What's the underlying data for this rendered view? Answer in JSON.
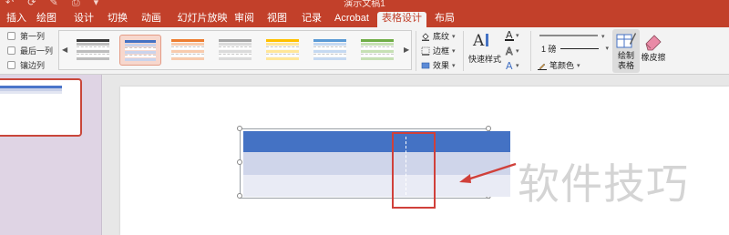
{
  "window": {
    "title": "演示文稿1",
    "accent": "#c2402a"
  },
  "tabs": [
    {
      "label": "插入"
    },
    {
      "label": "绘图"
    },
    {
      "label": "设计"
    },
    {
      "label": "切换"
    },
    {
      "label": "动画"
    },
    {
      "label": "幻灯片放映"
    },
    {
      "label": "审阅"
    },
    {
      "label": "视图"
    },
    {
      "label": "记录"
    },
    {
      "label": "Acrobat"
    },
    {
      "label": "表格设计",
      "active": true
    },
    {
      "label": "布局"
    }
  ],
  "ribbon": {
    "options": [
      {
        "label": "第一列",
        "checked": false
      },
      {
        "label": "最后一列",
        "checked": false
      },
      {
        "label": "镶边列",
        "checked": false
      }
    ],
    "styles_gallery": {
      "selected_index": 1,
      "styles": [
        {
          "header": "#3a3a3a",
          "band": "#bdbdbd"
        },
        {
          "header": "#4472c4",
          "band": "#c9d3ec"
        },
        {
          "header": "#ed7d31",
          "band": "#f8cbad"
        },
        {
          "header": "#a5a5a5",
          "band": "#dbdbdb"
        },
        {
          "header": "#ffc000",
          "band": "#ffe699"
        },
        {
          "header": "#5b9bd5",
          "band": "#c5d9f1"
        },
        {
          "header": "#70ad47",
          "band": "#c6e0b4"
        }
      ]
    },
    "shading_label": "底纹",
    "borders_label": "边框",
    "effects_label": "效果",
    "quick_styles_label": "快速样式",
    "pen_weight": "1 磅",
    "pen_color_label": "笔颜色",
    "draw_table_label": "绘制\n表格",
    "eraser_label": "橡皮擦"
  },
  "slide": {
    "table_colors": {
      "header": "#4472c4",
      "band1": "#cfd5ea",
      "band2": "#e9ebf5"
    },
    "annotation_color": "#d0403a"
  },
  "watermark": "软件技巧"
}
